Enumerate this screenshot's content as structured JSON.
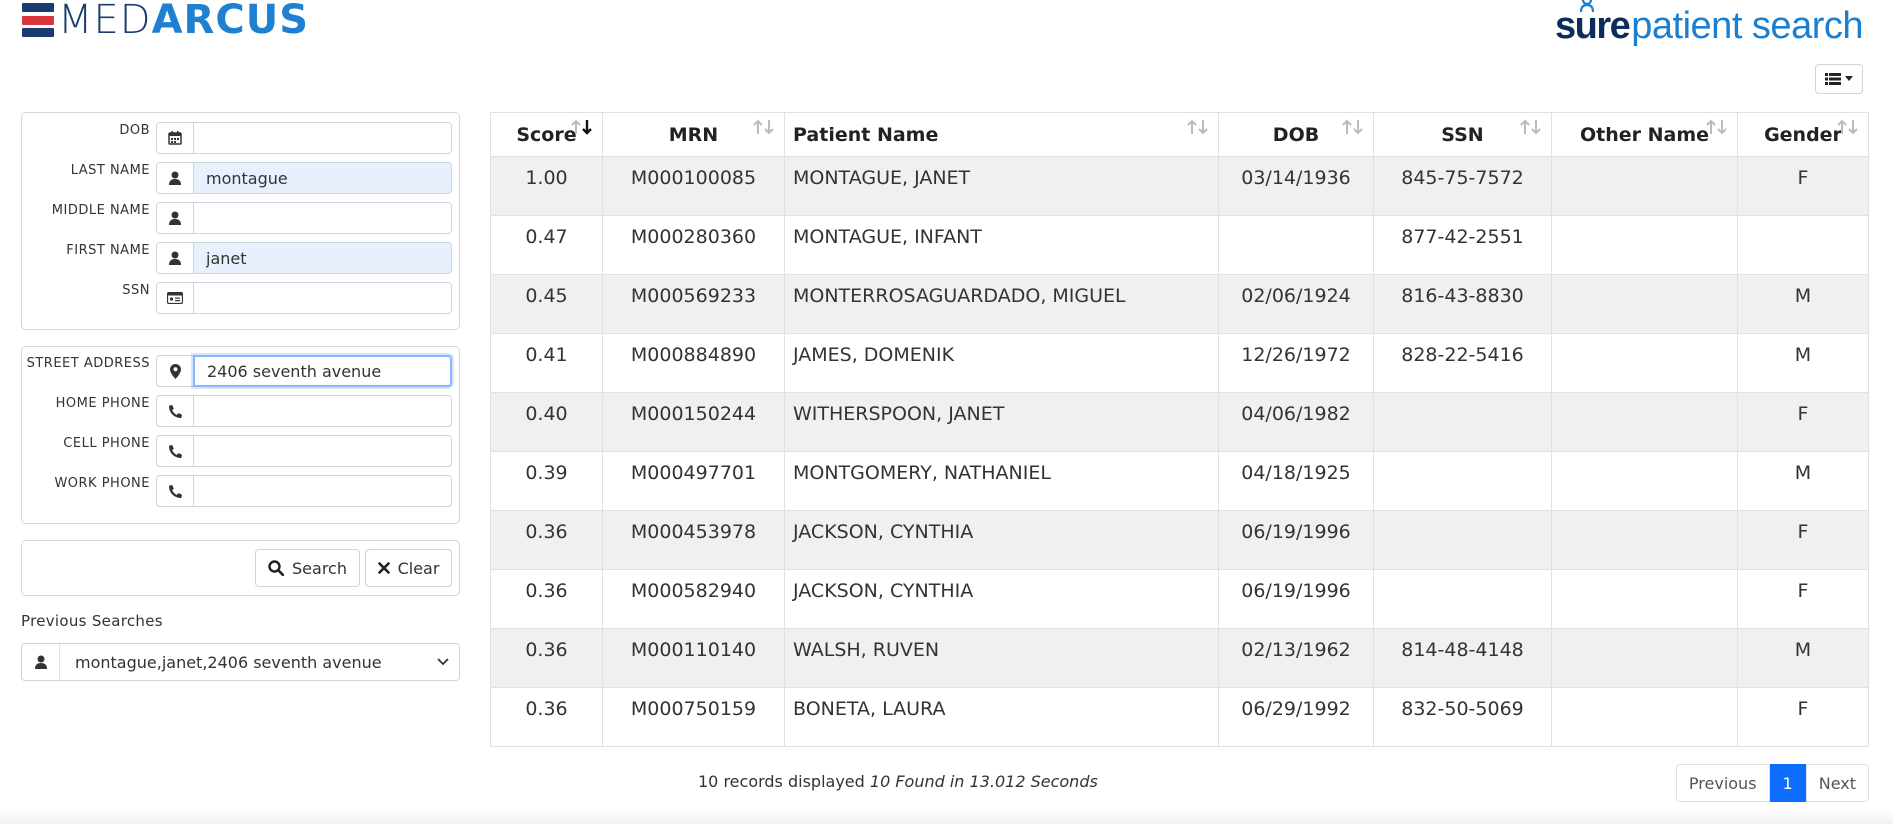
{
  "header": {
    "logo_left": {
      "part1": "MED",
      "part2": "ARCUS",
      "stripe_colors": [
        "#1a3c6e",
        "#d9363e",
        "#1a3c6e"
      ]
    },
    "brand": {
      "part1": "sure",
      "part2": "patient search"
    }
  },
  "colors": {
    "accent": "#0d6efd",
    "brand_blue": "#1f7fd0",
    "brand_navy": "#1a3c6e",
    "filled_input": "#e8f0fe"
  },
  "search_form": {
    "demographics": [
      {
        "label": "DOB",
        "icon": "calendar-icon",
        "value": ""
      },
      {
        "label": "LAST NAME",
        "icon": "user-icon",
        "value": "montague"
      },
      {
        "label": "MIDDLE NAME",
        "icon": "user-icon",
        "value": ""
      },
      {
        "label": "FIRST NAME",
        "icon": "user-icon",
        "value": "janet"
      },
      {
        "label": "SSN",
        "icon": "id-card-icon",
        "value": ""
      }
    ],
    "contact": [
      {
        "label": "STREET ADDRESS",
        "icon": "map-marker-icon",
        "value": "2406 seventh avenue"
      },
      {
        "label": "HOME PHONE",
        "icon": "phone-icon",
        "value": ""
      },
      {
        "label": "CELL PHONE",
        "icon": "phone-icon",
        "value": ""
      },
      {
        "label": "WORK PHONE",
        "icon": "phone-icon",
        "value": ""
      }
    ],
    "search_label": "Search",
    "clear_label": "Clear"
  },
  "previous_searches": {
    "label": "Previous Searches",
    "selected": "montague,janet,2406 seventh avenue"
  },
  "results": {
    "columns": [
      "Score",
      "MRN",
      "Patient Name",
      "DOB",
      "SSN",
      "Other Name",
      "Gender"
    ],
    "rows": [
      [
        "1.00",
        "M000100085",
        "MONTAGUE, JANET",
        "03/14/1936",
        "845-75-7572",
        "",
        "F"
      ],
      [
        "0.47",
        "M000280360",
        "MONTAGUE, INFANT",
        "",
        "877-42-2551",
        "",
        ""
      ],
      [
        "0.45",
        "M000569233",
        "MONTERROSAGUARDADO, MIGUEL",
        "02/06/1924",
        "816-43-8830",
        "",
        "M"
      ],
      [
        "0.41",
        "M000884890",
        "JAMES, DOMENIK",
        "12/26/1972",
        "828-22-5416",
        "",
        "M"
      ],
      [
        "0.40",
        "M000150244",
        "WITHERSPOON, JANET",
        "04/06/1982",
        "",
        "",
        "F"
      ],
      [
        "0.39",
        "M000497701",
        "MONTGOMERY, NATHANIEL",
        "04/18/1925",
        "",
        "",
        "M"
      ],
      [
        "0.36",
        "M000453978",
        "JACKSON, CYNTHIA",
        "06/19/1996",
        "",
        "",
        "F"
      ],
      [
        "0.36",
        "M000582940",
        "JACKSON, CYNTHIA",
        "06/19/1996",
        "",
        "",
        "F"
      ],
      [
        "0.36",
        "M000110140",
        "WALSH, RUVEN",
        "02/13/1962",
        "814-48-4148",
        "",
        "M"
      ],
      [
        "0.36",
        "M000750159",
        "BONETA, LAURA",
        "06/29/1992",
        "832-50-5069",
        "",
        "F"
      ]
    ],
    "footer": {
      "displayed": "10 records displayed",
      "found": "10 Found in 13.012 Seconds"
    }
  },
  "pagination": {
    "previous": "Previous",
    "current": "1",
    "next": "Next"
  }
}
